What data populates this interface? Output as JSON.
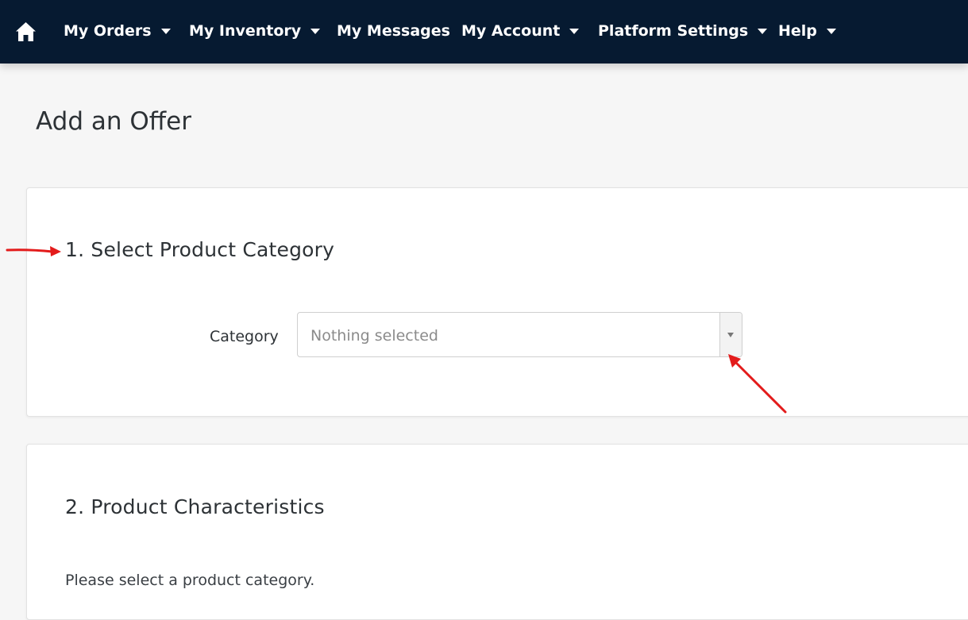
{
  "nav": {
    "home_icon": "home-icon",
    "items": [
      {
        "label": "My Orders",
        "has_dropdown": true
      },
      {
        "label": "My Inventory",
        "has_dropdown": true
      },
      {
        "label": "My Messages",
        "has_dropdown": false
      },
      {
        "label": "My Account",
        "has_dropdown": true
      },
      {
        "label": "Platform Settings",
        "has_dropdown": true
      },
      {
        "label": "Help",
        "has_dropdown": true
      }
    ]
  },
  "page": {
    "title": "Add an Offer"
  },
  "section1": {
    "title": "1. Select Product Category",
    "category_label": "Category",
    "category_select": {
      "placeholder": "Nothing selected"
    }
  },
  "section2": {
    "title": "2. Product Characteristics",
    "hint": "Please select a product category."
  },
  "colors": {
    "nav_background": "#061a31",
    "page_background": "#f6f6f6",
    "annotation_arrow": "#e31b1b"
  }
}
